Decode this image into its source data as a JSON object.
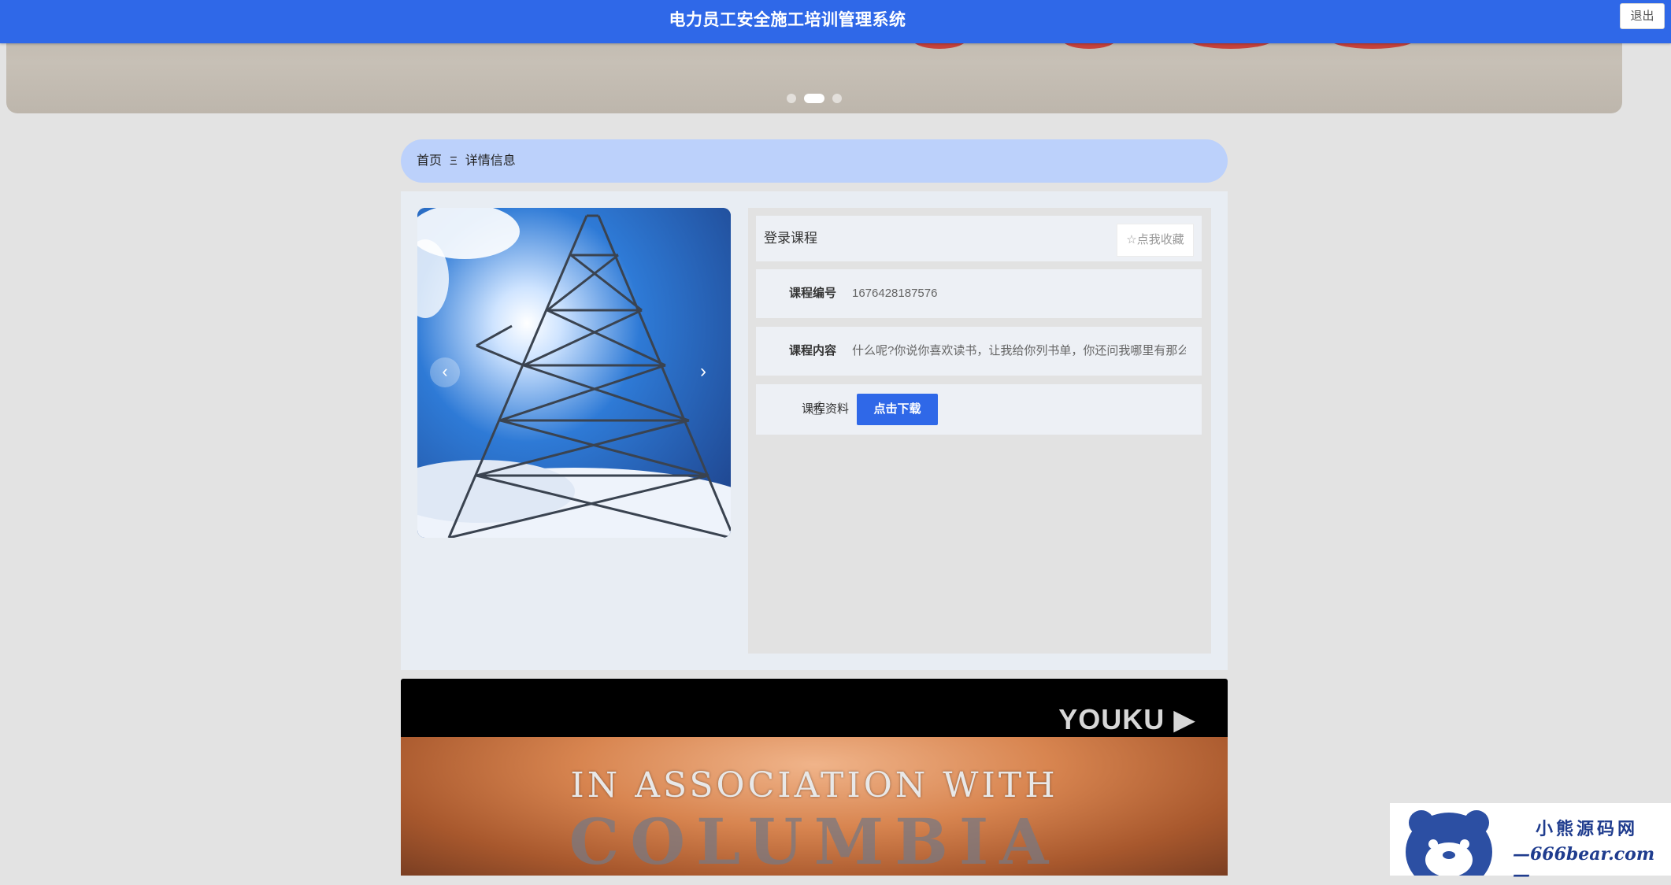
{
  "app": {
    "title": "电力员工安全施工培训管理系统",
    "logout_label": "退出",
    "accent_color": "#2f68e8"
  },
  "banner": {
    "dot_count": 3,
    "active_dot": 2
  },
  "breadcrumb": {
    "home": "首页",
    "separator": "Ξ",
    "current": "详情信息"
  },
  "gallery": {
    "prev_icon": "‹",
    "next_icon": "›"
  },
  "detail": {
    "course_title": "登录课程",
    "favorite_label": "☆点我收藏",
    "fields": [
      {
        "label": "课程编号",
        "value": "1676428187576"
      },
      {
        "label": "课程内容",
        "value": "什么呢?你说你喜欢读书，让我给你列书单，你还问我哪里有那么"
      }
    ],
    "download": {
      "label": "课程资料",
      "button": "点击下载"
    }
  },
  "video": {
    "brand": "YOUKU ▶",
    "caption": "IN ASSOCIATION WITH",
    "caption2": "COLUMBIA"
  },
  "watermark": {
    "name": "小熊源码网",
    "url": "—666bear.com—"
  }
}
